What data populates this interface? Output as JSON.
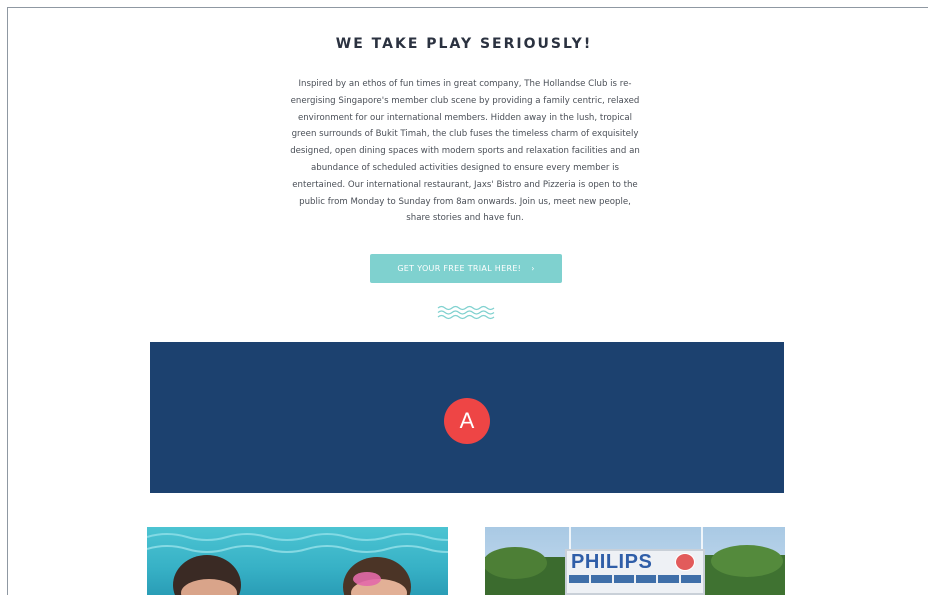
{
  "section": {
    "heading": "WE TAKE PLAY SERIOUSLY!",
    "intro_lines": [
      "Inspired by an ethos of fun times in great company, The Hollandse Club is re-",
      "energising Singapore's member club scene by providing a family centric, relaxed",
      "environment for our international members. Hidden away in the lush, tropical",
      "green surrounds of Bukit Timah, the club fuses the timeless charm of exquisitely",
      "designed, open dining spaces with modern sports and relaxation facilities and an",
      "abundance of scheduled activities designed to ensure every member is",
      "entertained. Our international restaurant, Jaxs' Bistro and Pizzeria is open to the",
      "public from Monday to Sunday from 8am onwards. Join us, meet new people,",
      "share stories and have fun."
    ],
    "cta_label": "GET YOUR FREE TRIAL HERE!",
    "cta_arrow": "›"
  },
  "banner": {
    "marker": "A",
    "color": "#1c416f",
    "marker_color": "#ee4545"
  },
  "photos": {
    "right_sign_text": "PHILIPS"
  },
  "colors": {
    "accent": "#7fd1cf",
    "heading": "#2b3240",
    "body_text": "#4a4f57"
  }
}
